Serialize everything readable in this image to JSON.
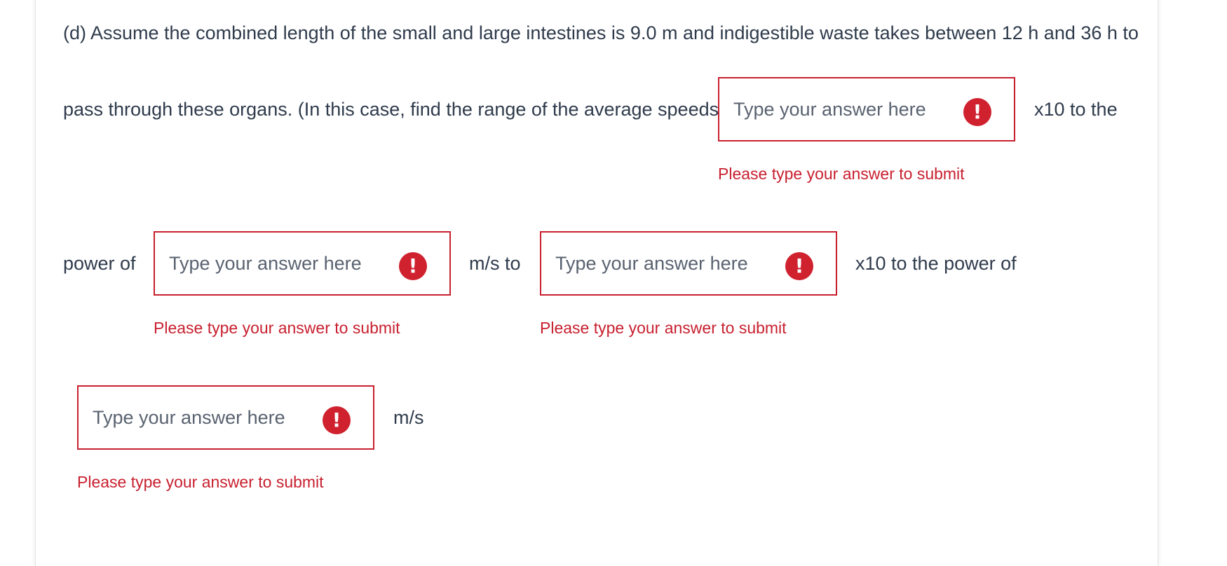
{
  "question": {
    "line1": "(d)   Assume the combined length of the small and large intestines is 9.0 m and indigestible waste takes between 12 h and 36 h to",
    "line2": "pass through these organs. (In this case, find the range of the average speeds.)",
    "after_field1": "x10 to the",
    "before_field2": "power of",
    "after_field2": "m/s to",
    "after_field3": "x10 to the power of",
    "after_field4": "m/s"
  },
  "fields": [
    {
      "placeholder": "Type your answer here",
      "value": "",
      "error": "Please type your answer to submit",
      "icon": "exclamation-icon"
    },
    {
      "placeholder": "Type your answer here",
      "value": "",
      "error": "Please type your answer to submit",
      "icon": "exclamation-icon"
    },
    {
      "placeholder": "Type your answer here",
      "value": "",
      "error": "Please type your answer to submit",
      "icon": "exclamation-icon"
    },
    {
      "placeholder": "Type your answer here",
      "value": "",
      "error": "Please type your answer to submit",
      "icon": "exclamation-icon"
    }
  ],
  "icon_glyph": "!",
  "colors": {
    "text": "#2f3b4c",
    "error": "#c8202f",
    "error_icon_bg": "#d0212f",
    "placeholder": "#596270"
  }
}
